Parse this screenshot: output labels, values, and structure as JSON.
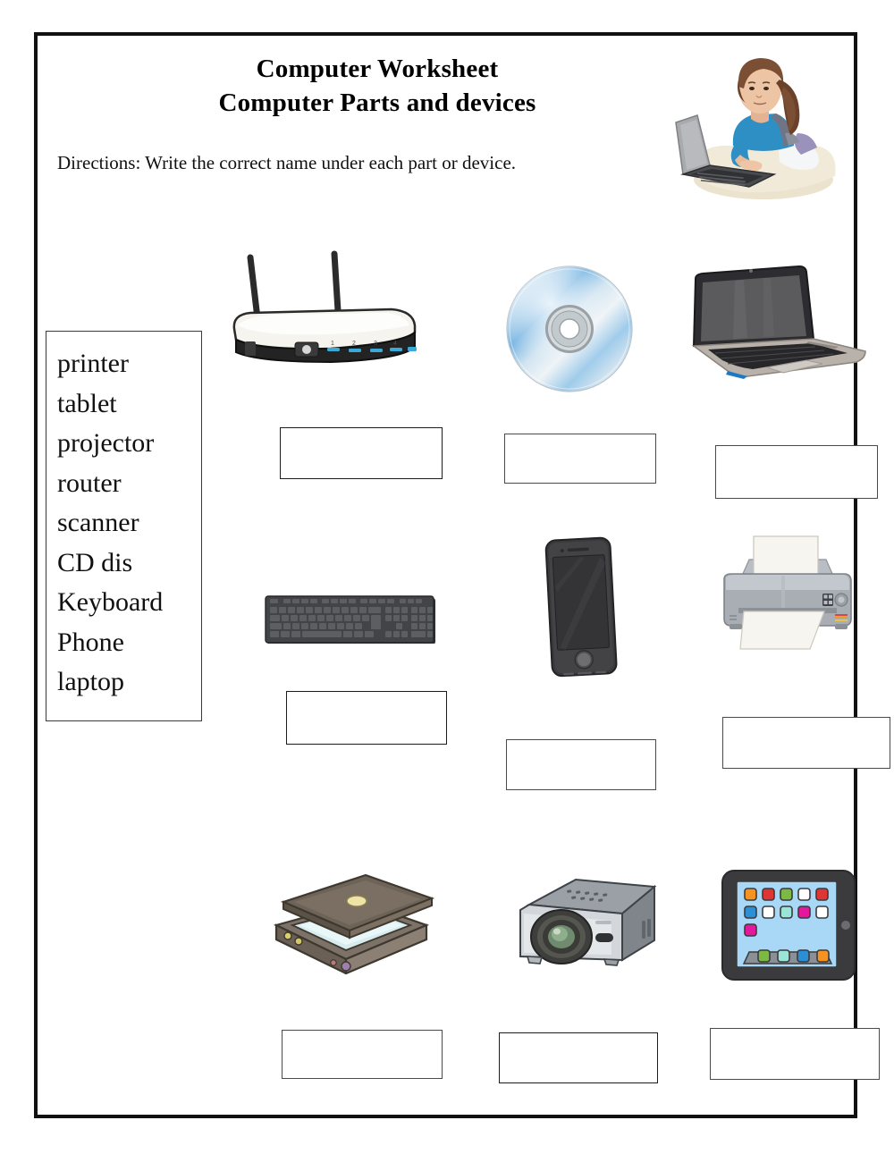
{
  "page": {
    "title_line_1": "Computer Worksheet",
    "title_line_2": "Computer Parts and devices",
    "directions": "Directions: Write the correct name under each part or device.",
    "border_color": "#111111",
    "background_color": "#ffffff"
  },
  "header_illustration": {
    "name": "girl-using-laptop-illustration",
    "hair_color": "#7b4f33",
    "shirt_color": "#2e8fc4",
    "desk_color": "#ece3cf",
    "laptop_color": "#a9aaae",
    "backpack_color": "#6f7584"
  },
  "word_bank": {
    "name": "word-bank",
    "words": [
      "printer",
      "tablet",
      "projector",
      "router",
      "scanner",
      "CD dis",
      "Keyboard",
      "Phone",
      "laptop"
    ]
  },
  "devices": [
    {
      "name": "router",
      "icon": "router-image",
      "answer": "",
      "answer_placeholder": ""
    },
    {
      "name": "cd-disc",
      "icon": "cd-disc-image",
      "answer": "",
      "answer_placeholder": ""
    },
    {
      "name": "laptop",
      "icon": "laptop-image",
      "answer": "",
      "answer_placeholder": ""
    },
    {
      "name": "keyboard",
      "icon": "keyboard-image",
      "answer": "",
      "answer_placeholder": ""
    },
    {
      "name": "phone",
      "icon": "smartphone-image",
      "answer": "",
      "answer_placeholder": ""
    },
    {
      "name": "printer",
      "icon": "printer-image",
      "answer": "",
      "answer_placeholder": ""
    },
    {
      "name": "scanner",
      "icon": "flatbed-scanner-image",
      "answer": "",
      "answer_placeholder": ""
    },
    {
      "name": "projector",
      "icon": "projector-image",
      "answer": "",
      "answer_placeholder": ""
    },
    {
      "name": "tablet",
      "icon": "tablet-image",
      "answer": "",
      "answer_placeholder": ""
    }
  ],
  "colors": {
    "router_body": "#f4f2ec",
    "router_base": "#232323",
    "router_led": "#3aa9d8",
    "cd_silver": "#dfe6ea",
    "cd_blue": "#5fa8dd",
    "cd_hub": "#9aa0a3",
    "laptop_screen": "#5b5b5d",
    "laptop_body": "#2d2d31",
    "laptop_deck": "#b8b2ab",
    "keyboard_body": "#434447",
    "keyboard_key": "#5c5e62",
    "phone_body": "#3a3a3c",
    "phone_screen": "#343436",
    "printer_body": "#a9aeb4",
    "printer_paper": "#f7f5ef",
    "scanner_lid": "#6d6357",
    "scanner_glass": "#d6ecef",
    "projector_body": "#c9cdd2",
    "projector_lens": "#2f3a33",
    "tablet_frame": "#3b3b3d",
    "tablet_screen": "#a8d8f5",
    "tablet_app_orange": "#f59322",
    "tablet_app_red": "#e03535",
    "tablet_app_green": "#7cb943",
    "tablet_app_white": "#ffffff",
    "tablet_app_blue": "#2b8fd6",
    "tablet_app_mint": "#9ae5d8",
    "tablet_app_magenta": "#e3189c",
    "tablet_dock": "#8b9096"
  }
}
